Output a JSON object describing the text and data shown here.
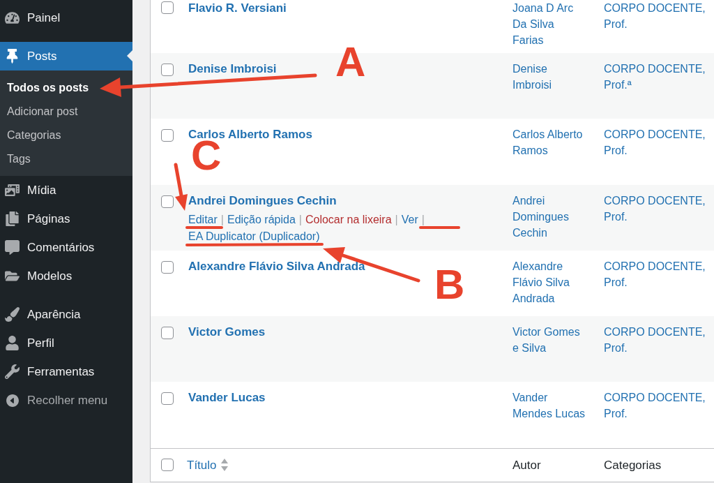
{
  "sidebar": {
    "menu_groups": [
      {
        "items": [
          {
            "label": "Painel",
            "selected": false
          }
        ]
      },
      {
        "items": [
          {
            "label": "Posts",
            "selected": true,
            "children": [
              {
                "label": "Todos os posts",
                "selected": true
              },
              {
                "label": "Adicionar post",
                "selected": false
              },
              {
                "label": "Categorias",
                "selected": false
              },
              {
                "label": "Tags",
                "selected": false
              }
            ]
          },
          {
            "label": "Mídia",
            "selected": false
          },
          {
            "label": "Páginas",
            "selected": false
          },
          {
            "label": "Comentários",
            "selected": false
          },
          {
            "label": "Modelos",
            "selected": false
          }
        ]
      },
      {
        "items": [
          {
            "label": "Aparência",
            "selected": false
          },
          {
            "label": "Perfil",
            "selected": false
          },
          {
            "label": "Ferramentas",
            "selected": false
          }
        ]
      }
    ],
    "collapse_label": "Recolher menu"
  },
  "posts_table": {
    "rows": [
      {
        "checked": false,
        "title": "Flavio R. Versiani",
        "author": "Joana D Arc Da Silva Farias",
        "categories": "CORPO DOCENTE, Prof."
      },
      {
        "checked": false,
        "title": "Denise Imbroisi",
        "author": "Denise Imbroisi",
        "categories": "CORPO DOCENTE, Prof.ª"
      },
      {
        "checked": false,
        "title": "Carlos Alberto Ramos",
        "author": "Carlos Alberto Ramos",
        "categories": "CORPO DOCENTE, Prof."
      },
      {
        "checked": false,
        "title": "Andrei Domingues Cechin",
        "author": "Andrei Domingues Cechin",
        "categories": "CORPO DOCENTE, Prof.",
        "row_actions": [
          {
            "label": "Editar",
            "kind": "link",
            "separator": "|"
          },
          {
            "label": "Edição rápida",
            "kind": "link",
            "separator": "|"
          },
          {
            "label": "Colocar na lixeira",
            "kind": "delete",
            "separator": "|"
          },
          {
            "label": "Ver",
            "kind": "link",
            "separator": "|"
          },
          {
            "label": "EA Duplicator (Duplicador)",
            "kind": "link"
          }
        ]
      },
      {
        "checked": false,
        "title": "Alexandre Flávio Silva Andrada",
        "author": "Alexandre Flávio Silva Andrada",
        "categories": "CORPO DOCENTE, Prof."
      },
      {
        "checked": false,
        "title": "Victor Gomes",
        "author": "Victor Gomes e Silva",
        "categories": "CORPO DOCENTE, Prof."
      },
      {
        "checked": false,
        "title": "Vander Lucas",
        "author": "Vander Mendes Lucas",
        "categories": "CORPO DOCENTE, Prof."
      }
    ],
    "footer": {
      "checked": false,
      "columns": [
        {
          "label": "Título",
          "sortable": true
        },
        {
          "label": "Autor",
          "sortable": false
        },
        {
          "label": "Categorias",
          "sortable": false
        }
      ]
    }
  },
  "annotations": [
    {
      "label": "A"
    },
    {
      "label": "B"
    },
    {
      "label": "C"
    }
  ]
}
